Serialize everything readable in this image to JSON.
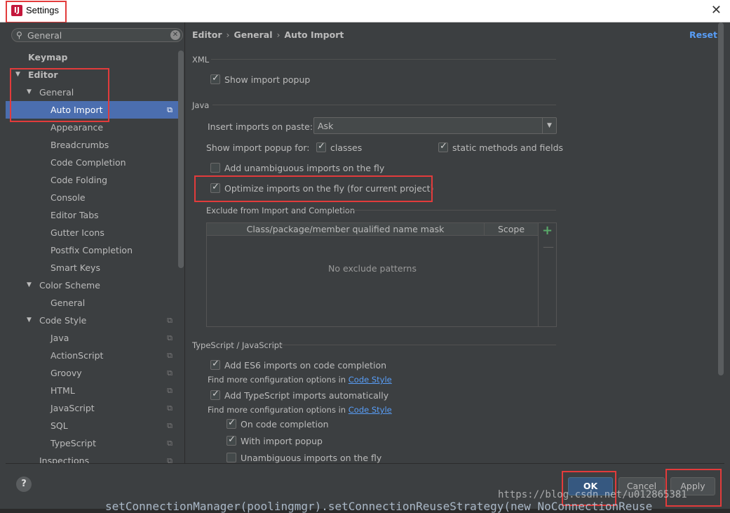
{
  "window": {
    "title": "Settings",
    "close_glyph": "✕"
  },
  "search": {
    "value": "General"
  },
  "sidebar": {
    "items": [
      {
        "label": "Keymap"
      },
      {
        "label": "Editor"
      },
      {
        "label": "General"
      },
      {
        "label": "Auto Import"
      },
      {
        "label": "Appearance"
      },
      {
        "label": "Breadcrumbs"
      },
      {
        "label": "Code Completion"
      },
      {
        "label": "Code Folding"
      },
      {
        "label": "Console"
      },
      {
        "label": "Editor Tabs"
      },
      {
        "label": "Gutter Icons"
      },
      {
        "label": "Postfix Completion"
      },
      {
        "label": "Smart Keys"
      },
      {
        "label": "Color Scheme"
      },
      {
        "label": "General"
      },
      {
        "label": "Code Style"
      },
      {
        "label": "Java"
      },
      {
        "label": "ActionScript"
      },
      {
        "label": "Groovy"
      },
      {
        "label": "HTML"
      },
      {
        "label": "JavaScript"
      },
      {
        "label": "SQL"
      },
      {
        "label": "TypeScript"
      },
      {
        "label": "Inspections"
      }
    ]
  },
  "breadcrumb": {
    "a": "Editor",
    "b": "General",
    "c": "Auto Import",
    "sep": "›"
  },
  "reset_label": "Reset",
  "xml": {
    "section": "XML",
    "show_import_popup": {
      "label": "Show import popup",
      "checked": true
    }
  },
  "java": {
    "section": "Java",
    "insert_label": "Insert imports on paste:",
    "insert_value": "Ask",
    "popup_for_label": "Show import popup for:",
    "classes": {
      "label": "classes",
      "checked": true
    },
    "static": {
      "label": "static methods and fields",
      "checked": true
    },
    "unambiguous": {
      "label": "Add unambiguous imports on the fly",
      "checked": false
    },
    "optimize": {
      "label": "Optimize imports on the fly (for current project)",
      "checked": true
    },
    "exclude_section": "Exclude from Import and Completion",
    "table_col1": "Class/package/member qualified name mask",
    "table_col2": "Scope",
    "table_empty": "No exclude patterns"
  },
  "ts": {
    "section": "TypeScript / JavaScript",
    "es6": {
      "label": "Add ES6 imports on code completion",
      "checked": true
    },
    "find_more": "Find more configuration options in",
    "code_style_link": "Code Style",
    "ts_auto": {
      "label": "Add TypeScript imports automatically",
      "checked": true
    },
    "on_completion": {
      "label": "On code completion",
      "checked": true
    },
    "with_popup": {
      "label": "With import popup",
      "checked": true
    },
    "unambiguous": {
      "label": "Unambiguous imports on the fly",
      "checked": false
    }
  },
  "buttons": {
    "help": "?",
    "ok": "OK",
    "cancel": "Cancel",
    "apply": "Apply"
  },
  "background_code": "setConnectionManager(poolingmgr).setConnectionReuseStrategy(new NoConnectionReuse",
  "watermark": "https://blog.csdn.net/u012865381"
}
